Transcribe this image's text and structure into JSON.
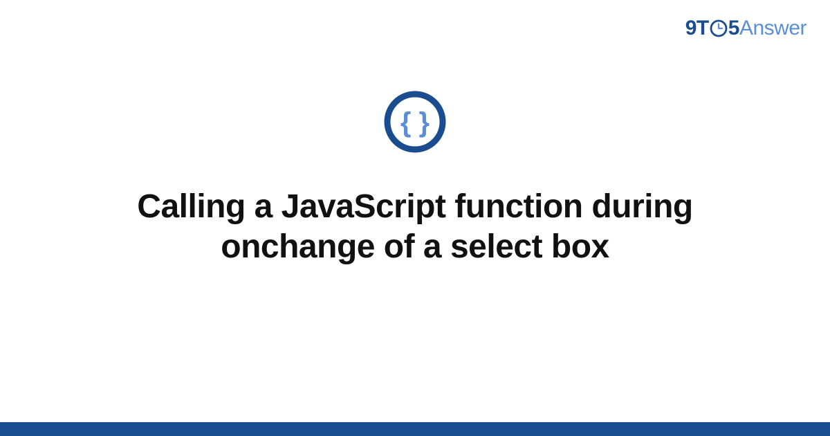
{
  "brand": {
    "part1": "9T",
    "part2": "5",
    "part3": "Answer"
  },
  "main": {
    "title": "Calling a JavaScript function during onchange of a select box"
  },
  "colors": {
    "brand_dark": "#1a4d8f",
    "brand_light": "#5a8fd4"
  }
}
